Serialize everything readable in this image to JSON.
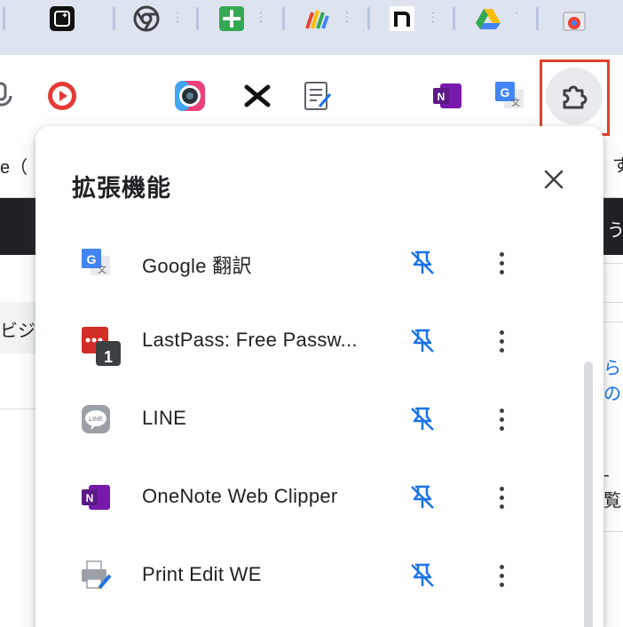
{
  "popup": {
    "title": "拡張機能",
    "close_icon": "close-icon",
    "extensions": [
      {
        "name": "Google 翻訳",
        "icon": "google-translate-icon",
        "pin_icon": "unpinned-icon"
      },
      {
        "name": "LastPass: Free Passw...",
        "icon": "lastpass-icon",
        "badge": "1",
        "pin_icon": "unpinned-icon"
      },
      {
        "name": "LINE",
        "icon": "line-icon",
        "pin_icon": "unpinned-icon"
      },
      {
        "name": "OneNote Web Clipper",
        "icon": "onenote-icon",
        "pin_icon": "unpinned-icon"
      },
      {
        "name": "Print Edit WE",
        "icon": "print-edit-icon",
        "pin_icon": "unpinned-icon"
      }
    ]
  },
  "toolbar": {
    "icons": [
      "youtube-icon",
      "camera-icon",
      "x-icon",
      "notes-icon",
      "onenote-icon",
      "google-translate-icon",
      "puzzle-extensions-icon"
    ]
  },
  "background": {
    "left_text_1": "e（",
    "left_text_2": "ビジ",
    "right_text_1": "す",
    "right_text_2": "う",
    "right_text_3": "らの",
    "right_text_4": "-覧"
  },
  "colors": {
    "accent_blue": "#1a73e8",
    "highlight_red": "#e0412a",
    "text": "#202124"
  }
}
